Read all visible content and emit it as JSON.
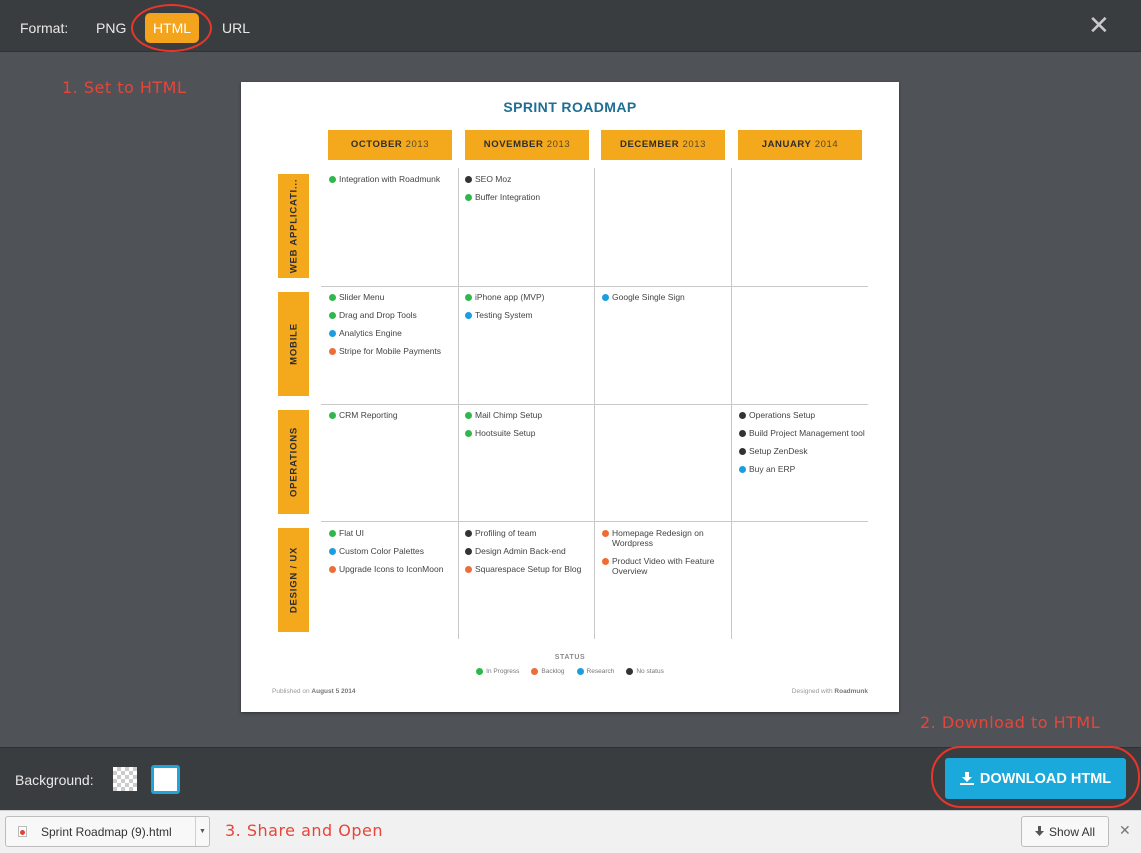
{
  "format_bar": {
    "label": "Format:",
    "options": [
      "PNG",
      "HTML",
      "URL"
    ],
    "selected": "HTML",
    "close_glyph": "✕"
  },
  "annotations": {
    "step1": "1. Set to HTML",
    "step2": "2. Download to HTML",
    "step3": "3. Share and Open"
  },
  "roadmap": {
    "title": "SPRINT ROADMAP",
    "columns": [
      {
        "month": "OCTOBER",
        "year": "2013"
      },
      {
        "month": "NOVEMBER",
        "year": "2013"
      },
      {
        "month": "DECEMBER",
        "year": "2013"
      },
      {
        "month": "JANUARY",
        "year": "2014"
      }
    ],
    "lanes": [
      {
        "name": "WEB APPLICATI...",
        "cells": [
          [
            {
              "text": "Integration with Roadmunk",
              "status": "in_progress"
            }
          ],
          [
            {
              "text": "SEO Moz",
              "status": "no_status"
            },
            {
              "text": "Buffer Integration",
              "status": "in_progress"
            }
          ],
          [],
          []
        ]
      },
      {
        "name": "MOBILE",
        "cells": [
          [
            {
              "text": "Slider Menu",
              "status": "in_progress"
            },
            {
              "text": "Drag and Drop Tools",
              "status": "in_progress"
            },
            {
              "text": "Analytics Engine",
              "status": "research"
            },
            {
              "text": "Stripe for Mobile Payments",
              "status": "backlog"
            }
          ],
          [
            {
              "text": "iPhone app (MVP)",
              "status": "in_progress"
            },
            {
              "text": "Testing System",
              "status": "research"
            }
          ],
          [
            {
              "text": "Google Single Sign",
              "status": "research"
            }
          ],
          []
        ]
      },
      {
        "name": "OPERATIONS",
        "cells": [
          [
            {
              "text": "CRM Reporting",
              "status": "in_progress"
            }
          ],
          [
            {
              "text": "Mail Chimp Setup",
              "status": "in_progress"
            },
            {
              "text": "Hootsuite Setup",
              "status": "in_progress"
            }
          ],
          [],
          [
            {
              "text": "Operations Setup",
              "status": "no_status"
            },
            {
              "text": "Build Project Management tool",
              "status": "no_status"
            },
            {
              "text": "Setup ZenDesk",
              "status": "no_status"
            },
            {
              "text": "Buy an ERP",
              "status": "research"
            }
          ]
        ]
      },
      {
        "name": "DESIGN / UX",
        "cells": [
          [
            {
              "text": "Flat UI",
              "status": "in_progress"
            },
            {
              "text": "Custom Color Palettes",
              "status": "research"
            },
            {
              "text": "Upgrade Icons to IconMoon",
              "status": "backlog"
            }
          ],
          [
            {
              "text": "Profiling of team",
              "status": "no_status"
            },
            {
              "text": "Design Admin Back-end",
              "status": "no_status"
            },
            {
              "text": "Squarespace Setup for Blog",
              "status": "backlog"
            }
          ],
          [
            {
              "text": "Homepage Redesign on Wordpress",
              "status": "backlog"
            },
            {
              "text": "Product Video with Feature Overview",
              "status": "backlog"
            }
          ],
          []
        ]
      }
    ],
    "status_title": "STATUS",
    "status_legend": [
      {
        "key": "in_progress",
        "label": "In Progress",
        "color": "#2eb84b"
      },
      {
        "key": "backlog",
        "label": "Backlog",
        "color": "#ef6c35"
      },
      {
        "key": "research",
        "label": "Research",
        "color": "#1a9ee0"
      },
      {
        "key": "no_status",
        "label": "No status",
        "color": "#333333"
      }
    ],
    "footer_left_prefix": "Published on",
    "footer_left_date": "August 5 2014",
    "footer_right_prefix": "Designed with",
    "footer_right_brand": "Roadmunk"
  },
  "background_bar": {
    "label": "Background:",
    "selected": "white"
  },
  "download_button": {
    "label": "DOWNLOAD HTML",
    "icon": "download-icon"
  },
  "downloads_bar": {
    "file_name": "Sprint Roadmap (9).html",
    "show_all": "Show All",
    "close_glyph": "✕"
  }
}
